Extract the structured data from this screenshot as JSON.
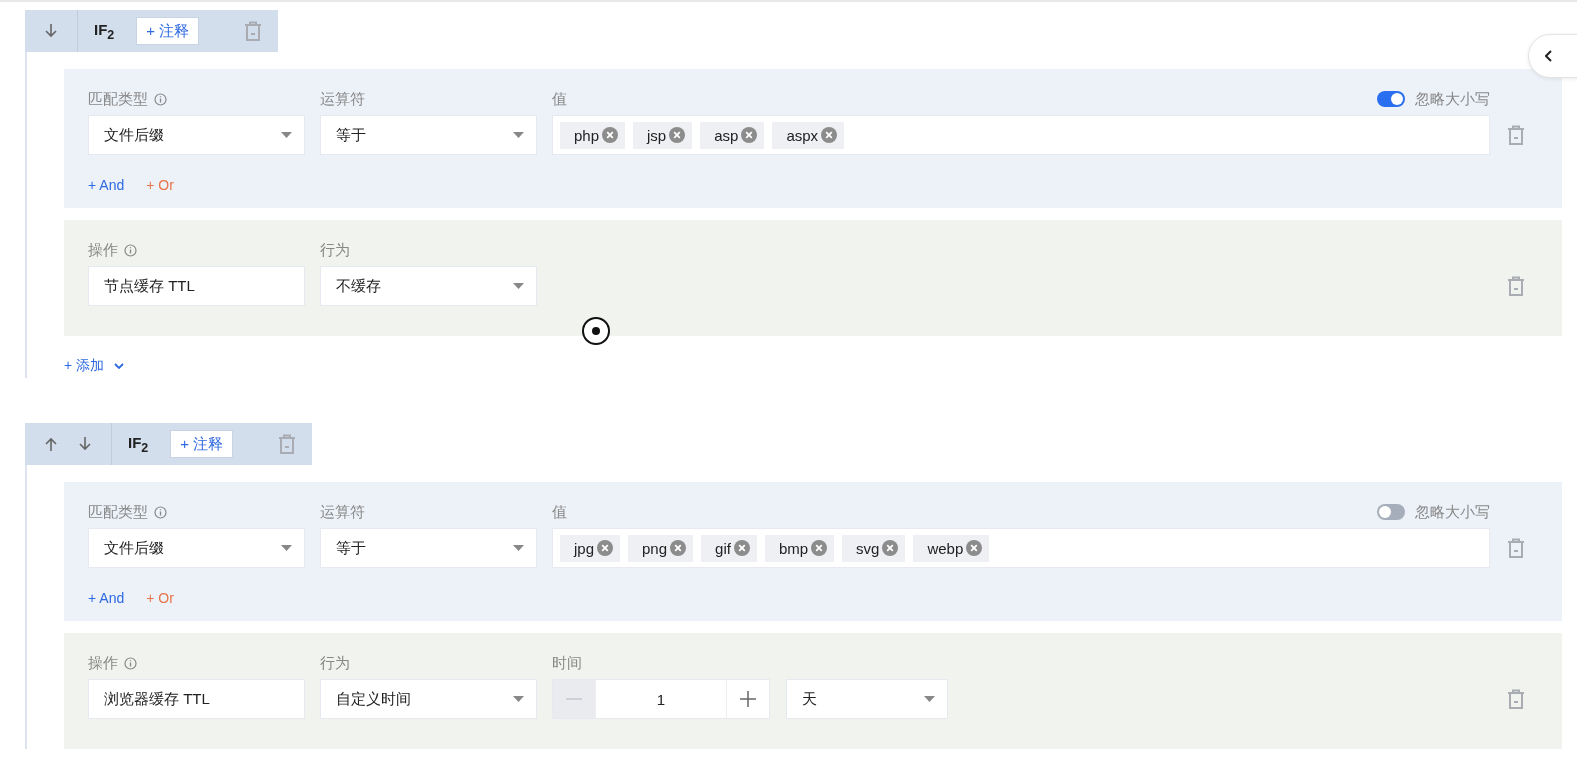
{
  "rules": [
    {
      "move_buttons": [
        {
          "kind": "down"
        }
      ],
      "title": "IF$_{2}$",
      "note_button": "+ 注释",
      "condition": {
        "match_type_label": "匹配类型",
        "match_type_value": "文件后缀",
        "operator_label": "运算符",
        "operator_value": "等于",
        "value_label": "值",
        "ignore_case": {
          "label": "忽略大小写",
          "on": true
        },
        "tags": [
          "php",
          "jsp",
          "asp",
          "aspx"
        ],
        "and_button": "+ And",
        "or_button": "+ Or"
      },
      "action": {
        "operation_label": "操作",
        "operation_value": "节点缓存 TTL",
        "behavior_label": "行为",
        "behavior_value": "不缓存"
      },
      "add_button": "+ 添加"
    },
    {
      "move_buttons": [
        {
          "kind": "up"
        },
        {
          "kind": "down"
        }
      ],
      "title": "IF$_{2}$",
      "note_button": "+ 注释",
      "condition": {
        "match_type_label": "匹配类型",
        "match_type_value": "文件后缀",
        "operator_label": "运算符",
        "operator_value": "等于",
        "value_label": "值",
        "ignore_case": {
          "label": "忽略大小写",
          "on": false
        },
        "tags": [
          "jpg",
          "png",
          "gif",
          "bmp",
          "svg",
          "webp"
        ],
        "and_button": "+ And",
        "or_button": "+ Or"
      },
      "action": {
        "operation_label": "操作",
        "operation_value": "浏览器缓存 TTL",
        "behavior_label": "行为",
        "behavior_value": "自定义时间",
        "time": {
          "label": "时间",
          "value": "1",
          "unit": "天",
          "decrement_disabled": true
        }
      }
    }
  ]
}
